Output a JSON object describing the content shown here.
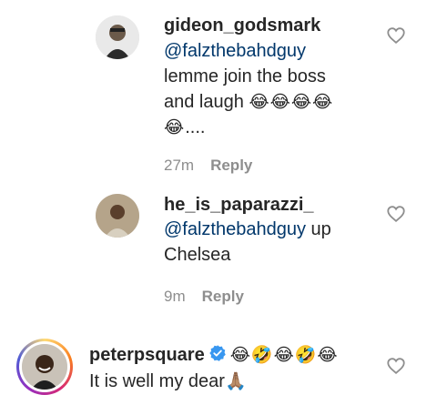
{
  "comments": [
    {
      "username": "gideon_godsmark",
      "mention": "@falzthebahdguy",
      "text_line1": "lemme join the boss",
      "text_line2": "and laugh",
      "emoji_line1": "😂😂😂😂",
      "emoji_line2": "😂",
      "suffix": "....",
      "time": "27m",
      "reply_label": "Reply"
    },
    {
      "username": "he_is_paparazzi_",
      "mention": "@falzthebahdguy",
      "text_after_mention": " up",
      "text_line2": "Chelsea",
      "time": "9m",
      "reply_label": "Reply"
    },
    {
      "username": "peterpsquare",
      "emoji_after_name": "😂🤣😂🤣😂",
      "text_line1": "It is well my dear",
      "emoji_end": "🙏🏽"
    }
  ],
  "colors": {
    "mention": "#00376b",
    "meta": "#8e8e8e",
    "verified": "#3897f0"
  },
  "icons": {
    "like": "heart-outline-icon",
    "verified": "verified-badge-icon"
  }
}
